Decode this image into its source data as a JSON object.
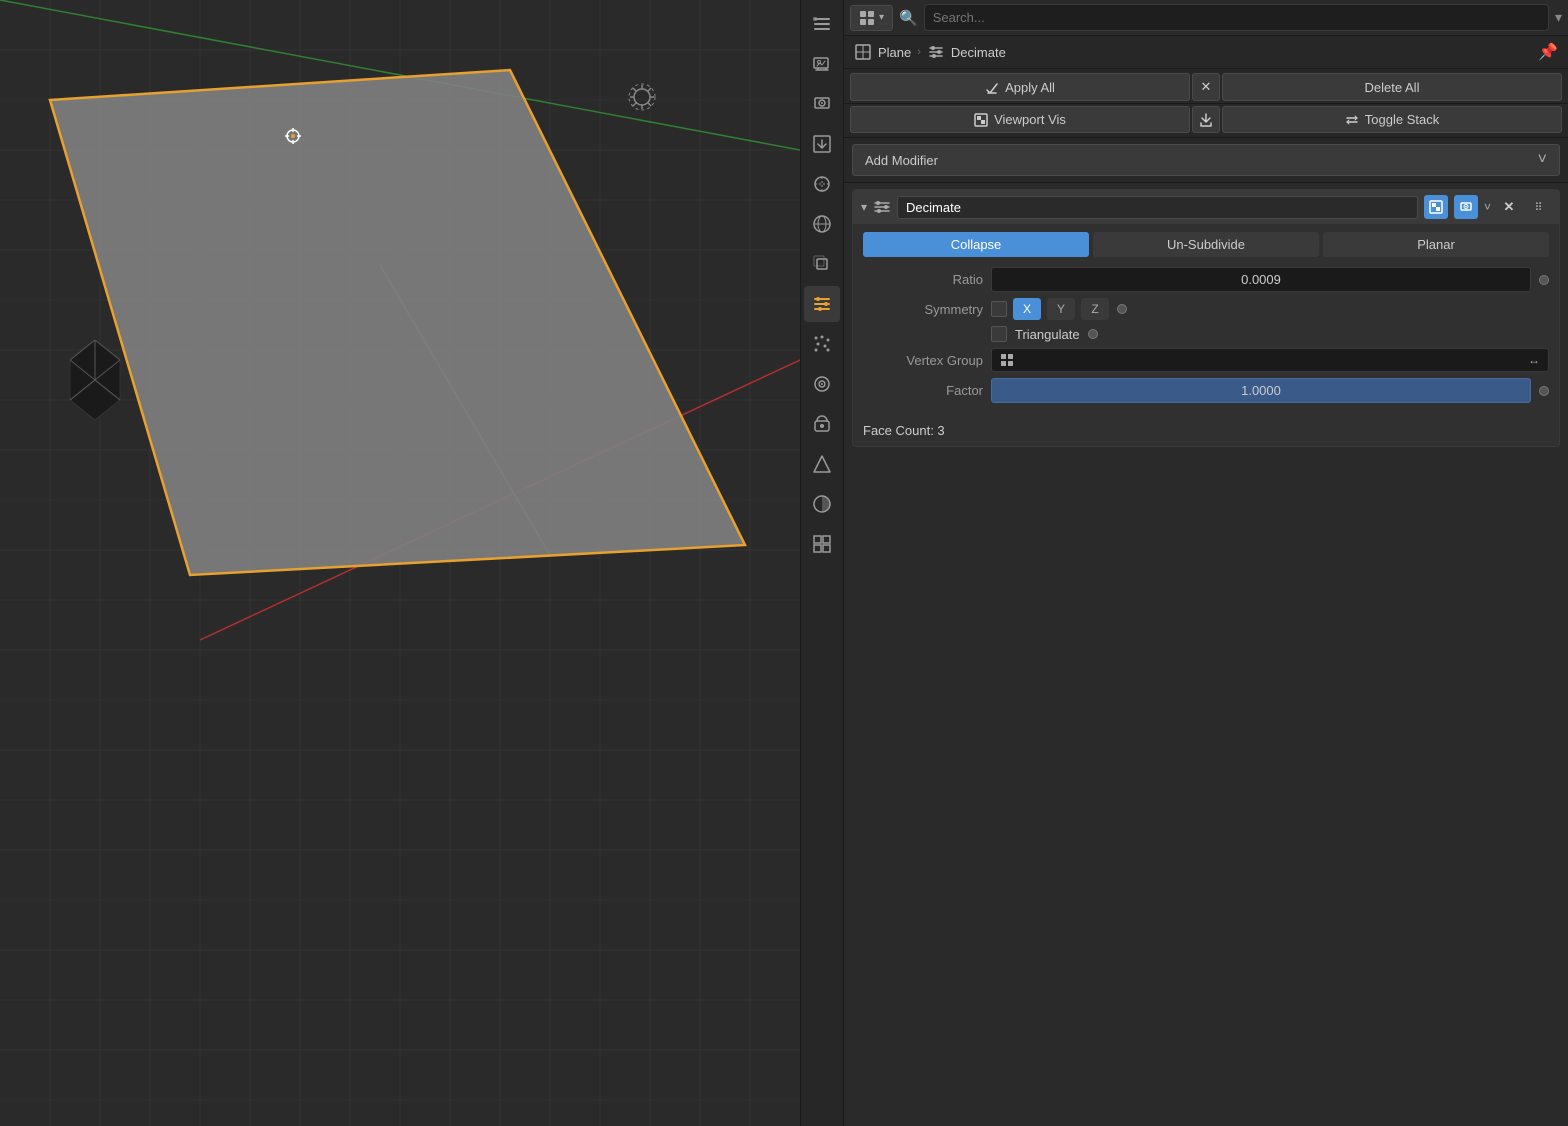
{
  "viewport": {
    "bg_color": "#2a2a2a"
  },
  "sidebar": {
    "icons": [
      {
        "name": "tools-icon",
        "symbol": "🔧",
        "active": false
      },
      {
        "name": "scene-icon",
        "symbol": "📷",
        "active": false
      },
      {
        "name": "render-icon",
        "symbol": "🖥",
        "active": false
      },
      {
        "name": "output-icon",
        "symbol": "🖼",
        "active": false
      },
      {
        "name": "paint-icon",
        "symbol": "💧",
        "active": false
      },
      {
        "name": "world-icon",
        "symbol": "🌐",
        "active": false
      },
      {
        "name": "object-icon",
        "symbol": "📦",
        "active": false
      },
      {
        "name": "modifier-icon",
        "symbol": "🔧",
        "active": true
      },
      {
        "name": "particles-icon",
        "symbol": "✦",
        "active": false
      },
      {
        "name": "physics-icon",
        "symbol": "◉",
        "active": false
      },
      {
        "name": "constraints-icon",
        "symbol": "🔗",
        "active": false
      },
      {
        "name": "data-icon",
        "symbol": "△",
        "active": false
      },
      {
        "name": "material-icon",
        "symbol": "◑",
        "active": false
      },
      {
        "name": "texture-icon",
        "symbol": "⊞",
        "active": false
      }
    ]
  },
  "header": {
    "search_placeholder": "Search...",
    "breadcrumb_icon": "▣",
    "breadcrumb_object": "Plane",
    "breadcrumb_separator": "›",
    "breadcrumb_modifier_icon": "▣",
    "breadcrumb_modifier": "Decimate",
    "pin_icon": "📌"
  },
  "modifier_actions": {
    "apply_all_label": "Apply All",
    "delete_all_label": "Delete All",
    "viewport_vis_label": "Viewport Vis",
    "toggle_stack_label": "Toggle Stack",
    "close_symbol": "✕",
    "export_symbol": "↓",
    "viewport_symbol": "▣"
  },
  "add_modifier": {
    "label": "Add Modifier",
    "chevron": "˅"
  },
  "decimate_modifier": {
    "name": "Decimate",
    "collapse_symbol": "▾",
    "modifier_icon": "▣",
    "realtime_btn": "▣",
    "render_btn": "📷",
    "chevron": "˅",
    "close": "✕",
    "dots": "⠿",
    "tabs": [
      {
        "label": "Collapse",
        "active": true
      },
      {
        "label": "Un-Subdivide",
        "active": false
      },
      {
        "label": "Planar",
        "active": false
      }
    ],
    "ratio": {
      "label": "Ratio",
      "value": "0.0009"
    },
    "symmetry": {
      "label": "Symmetry",
      "x": "X",
      "y": "Y",
      "z": "Z"
    },
    "triangulate": {
      "label": "Triangulate"
    },
    "vertex_group": {
      "label": "Vertex Group",
      "icon": "⊞",
      "arrows": "↔"
    },
    "factor": {
      "label": "Factor",
      "value": "1.0000"
    },
    "face_count": "Face Count: 3"
  }
}
